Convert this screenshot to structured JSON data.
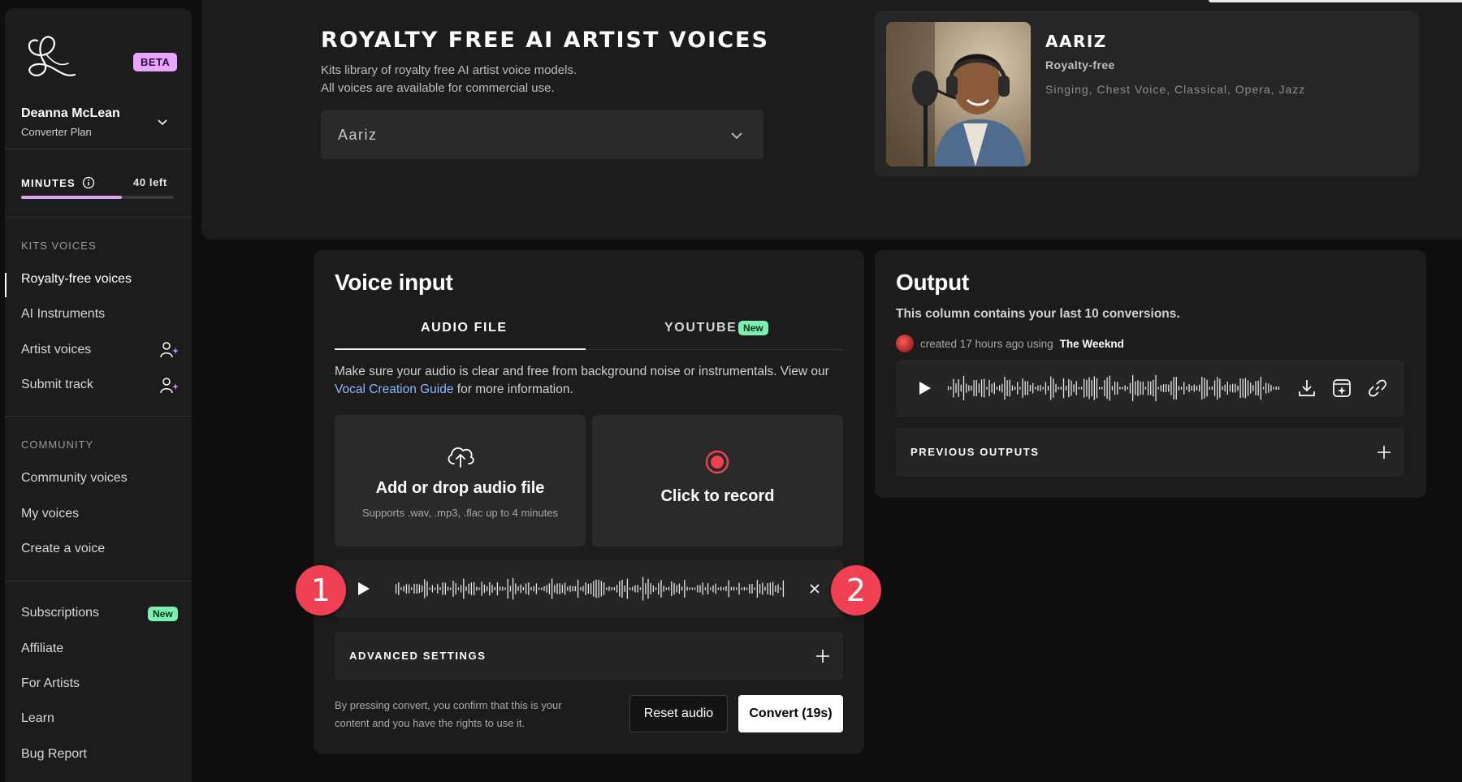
{
  "sidebar": {
    "beta": "BETA",
    "user": {
      "name": "Deanna McLean",
      "plan": "Converter Plan"
    },
    "minutes": {
      "label": "MINUTES",
      "left": "40 left",
      "used_fraction": 0.66
    },
    "sections": [
      {
        "title": "KITS VOICES",
        "items": [
          "Royalty-free voices",
          "AI Instruments",
          "Artist voices",
          "Submit track"
        ]
      },
      {
        "title": "COMMUNITY",
        "items": [
          "Community voices",
          "My voices",
          "Create a voice"
        ]
      },
      {
        "title": "",
        "items": [
          "Subscriptions",
          "Affiliate",
          "For Artists",
          "Learn",
          "Bug Report"
        ]
      }
    ],
    "new_badge": "New"
  },
  "header": {
    "title": "ROYALTY FREE AI ARTIST VOICES",
    "sub1": "Kits library of royalty free AI artist voice models.",
    "sub2": "All voices are available for commercial use.",
    "voice_select": "Aariz"
  },
  "artist": {
    "name": "AARIZ",
    "license": "Royalty-free",
    "tags": "Singing, Chest Voice, Classical, Opera, Jazz"
  },
  "voice_input": {
    "title": "Voice input",
    "tabs": [
      "AUDIO FILE",
      "YOUTUBE"
    ],
    "tab_new": "New",
    "hint_pre": "Make sure your audio is clear and free from background noise or instrumentals. View our",
    "hint_link": "Vocal Creation Guide",
    "hint_post": "for more information.",
    "upload_title": "Add or drop audio file",
    "upload_sub": "Supports .wav, .mp3, .flac up to 4 minutes",
    "record_title": "Click to record",
    "advanced": "ADVANCED SETTINGS",
    "legal": "By pressing convert, you confirm that this is your content and you have the rights to use it.",
    "reset": "Reset audio",
    "convert": "Convert (19s)"
  },
  "markers": [
    "1",
    "2"
  ],
  "output": {
    "title": "Output",
    "desc": "This column contains your last 10 conversions.",
    "meta": "created 17 hours ago using",
    "meta_artist": "The Weeknd",
    "previous": "PREVIOUS OUTPUTS"
  },
  "colors": {
    "accent": "#d9a6f5",
    "beta": "#e9a5ff",
    "new": "#7cf0b2",
    "link": "#8fb4ff",
    "record": "#ef4153",
    "marker": "#ef4153"
  }
}
